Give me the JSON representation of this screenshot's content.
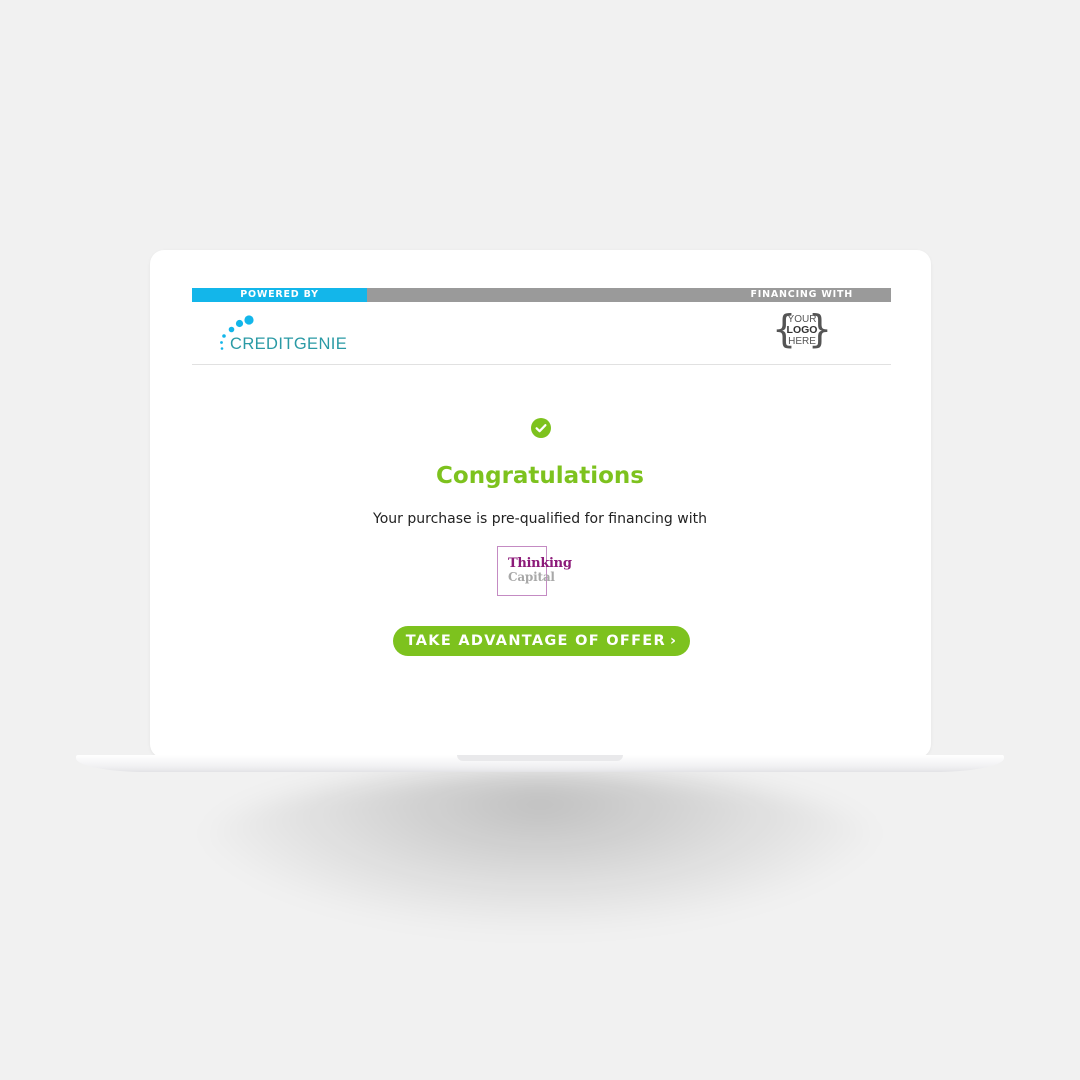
{
  "header": {
    "powered_by_label": "POWERED BY",
    "financing_with_label": "FINANCING WITH",
    "brand_logo_text": "CREDITGENIE",
    "partner_logo_lines": [
      "YOUR",
      "LOGO",
      "HERE"
    ]
  },
  "main": {
    "status_icon": "check-circle-icon",
    "title": "Congratulations",
    "subtitle": "Your purchase is pre-qualified for financing with",
    "lender_logo_lines": [
      "Thinking",
      "Capital"
    ],
    "cta_label": "TAKE ADVANTAGE OF OFFER",
    "cta_icon": "chevron-right-icon"
  },
  "colors": {
    "accent_green": "#7dc21e",
    "powered_by_blue": "#13b6ea",
    "strip_gray": "#9a9a9a",
    "brand_teal": "#2a9aa5",
    "lender_purple": "#8c1a79"
  }
}
